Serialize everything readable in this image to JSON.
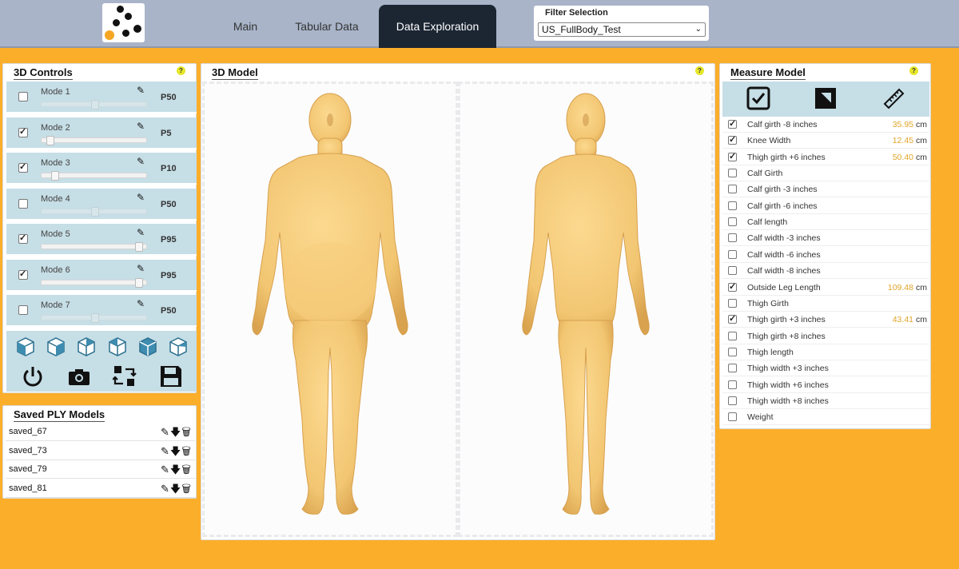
{
  "header": {
    "tabs": [
      {
        "label": "Main"
      },
      {
        "label": "Tabular Data"
      },
      {
        "label": "Data Exploration"
      }
    ],
    "filter": {
      "label": "Filter Selection",
      "selected": "US_FullBody_Test"
    }
  },
  "controls": {
    "title": "3D Controls",
    "modes": [
      {
        "label": "Mode 1",
        "checked": false,
        "percentile": "P50",
        "slider": 0.5,
        "slider_visible": false
      },
      {
        "label": "Mode 2",
        "checked": true,
        "percentile": "P5",
        "slider": 0.05,
        "slider_visible": true
      },
      {
        "label": "Mode 3",
        "checked": true,
        "percentile": "P10",
        "slider": 0.1,
        "slider_visible": true
      },
      {
        "label": "Mode 4",
        "checked": false,
        "percentile": "P50",
        "slider": 0.5,
        "slider_visible": false
      },
      {
        "label": "Mode 5",
        "checked": true,
        "percentile": "P95",
        "slider": 0.95,
        "slider_visible": true
      },
      {
        "label": "Mode 6",
        "checked": true,
        "percentile": "P95",
        "slider": 0.95,
        "slider_visible": true
      },
      {
        "label": "Mode 7",
        "checked": false,
        "percentile": "P50",
        "slider": 0.5,
        "slider_visible": false
      }
    ],
    "view_icons": [
      "cube-front-icon",
      "cube-left-icon",
      "cube-right-icon",
      "cube-top-icon",
      "cube-back-icon",
      "cube-side-icon"
    ],
    "action_icons": [
      "power-icon",
      "camera-icon",
      "swap-icon",
      "save-icon"
    ]
  },
  "saved": {
    "title": "Saved PLY Models",
    "items": [
      {
        "name": "saved_67"
      },
      {
        "name": "saved_73"
      },
      {
        "name": "saved_79"
      },
      {
        "name": "saved_81"
      }
    ]
  },
  "model": {
    "title": "3D Model"
  },
  "measure": {
    "title": "Measure Model",
    "tools": [
      "checkbox-icon",
      "bounding-box-icon",
      "ruler-icon"
    ],
    "items": [
      {
        "name": "Calf girth -8 inches",
        "checked": true,
        "value": "35.95",
        "unit": "cm"
      },
      {
        "name": "Knee Width",
        "checked": true,
        "value": "12.45",
        "unit": "cm"
      },
      {
        "name": "Thigh girth +6 inches",
        "checked": true,
        "value": "50.40",
        "unit": "cm"
      },
      {
        "name": "Calf Girth",
        "checked": false,
        "value": "",
        "unit": ""
      },
      {
        "name": "Calf girth -3 inches",
        "checked": false,
        "value": "",
        "unit": ""
      },
      {
        "name": "Calf girth -6 inches",
        "checked": false,
        "value": "",
        "unit": ""
      },
      {
        "name": "Calf length",
        "checked": false,
        "value": "",
        "unit": ""
      },
      {
        "name": "Calf width -3 inches",
        "checked": false,
        "value": "",
        "unit": ""
      },
      {
        "name": "Calf width -6 inches",
        "checked": false,
        "value": "",
        "unit": ""
      },
      {
        "name": "Calf width -8 inches",
        "checked": false,
        "value": "",
        "unit": ""
      },
      {
        "name": "Outside Leg Length",
        "checked": true,
        "value": "109.48",
        "unit": "cm"
      },
      {
        "name": "Thigh Girth",
        "checked": false,
        "value": "",
        "unit": ""
      },
      {
        "name": "Thigh girth +3 inches",
        "checked": true,
        "value": "43.41",
        "unit": "cm"
      },
      {
        "name": "Thigh girth +8 inches",
        "checked": false,
        "value": "",
        "unit": ""
      },
      {
        "name": "Thigh length",
        "checked": false,
        "value": "",
        "unit": ""
      },
      {
        "name": "Thigh width +3 inches",
        "checked": false,
        "value": "",
        "unit": ""
      },
      {
        "name": "Thigh width +6 inches",
        "checked": false,
        "value": "",
        "unit": ""
      },
      {
        "name": "Thigh width +8 inches",
        "checked": false,
        "value": "",
        "unit": ""
      },
      {
        "name": "Weight",
        "checked": false,
        "value": "",
        "unit": ""
      }
    ]
  },
  "colors": {
    "accent": "#FBAE2A",
    "header": "#A9B4C9",
    "active_tab": "#1C2633",
    "panel_tint": "#C6DEE6",
    "measure_value": "#E0A52A",
    "skin": "#F3C978"
  }
}
